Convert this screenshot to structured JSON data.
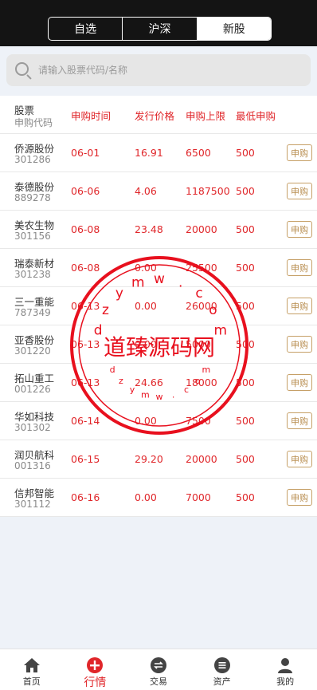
{
  "tabs": [
    {
      "label": "自选",
      "active": false
    },
    {
      "label": "沪深",
      "active": false
    },
    {
      "label": "新股",
      "active": true
    }
  ],
  "search": {
    "placeholder": "请输入股票代码/名称"
  },
  "table": {
    "headers": {
      "stock": "股票",
      "code": "申购代码",
      "date": "申购时间",
      "price": "发行价格",
      "limit": "申购上限",
      "min": "最低申购"
    },
    "apply_label": "申购",
    "rows": [
      {
        "name": "侨源股份",
        "code": "301286",
        "date": "06-01",
        "price": "16.91",
        "limit": "6500",
        "min": "500"
      },
      {
        "name": "泰德股份",
        "code": "889278",
        "date": "06-06",
        "price": "4.06",
        "limit": "1187500",
        "min": "500"
      },
      {
        "name": "美农生物",
        "code": "301156",
        "date": "06-08",
        "price": "23.48",
        "limit": "20000",
        "min": "500"
      },
      {
        "name": "瑞泰新材",
        "code": "301238",
        "date": "06-08",
        "price": "0.00",
        "limit": "25500",
        "min": "500"
      },
      {
        "name": "三一重能",
        "code": "787349",
        "date": "06-13",
        "price": "0.00",
        "limit": "26000",
        "min": "500"
      },
      {
        "name": "亚香股份",
        "code": "301220",
        "date": "06-13",
        "price": "0.00",
        "limit": "5000",
        "min": "500"
      },
      {
        "name": "拓山重工",
        "code": "001226",
        "date": "06-13",
        "price": "24.66",
        "limit": "18000",
        "min": "500"
      },
      {
        "name": "华如科技",
        "code": "301302",
        "date": "06-14",
        "price": "0.00",
        "limit": "7500",
        "min": "500"
      },
      {
        "name": "润贝航科",
        "code": "001316",
        "date": "06-15",
        "price": "29.20",
        "limit": "20000",
        "min": "500"
      },
      {
        "name": "信邦智能",
        "code": "301112",
        "date": "06-16",
        "price": "0.00",
        "limit": "7000",
        "min": "500"
      }
    ]
  },
  "watermark": {
    "text": "道臻源码网",
    "arc_text": "dzymw.com",
    "color": "#e8101e"
  },
  "bottom_nav": [
    {
      "label": "首页",
      "icon": "home-icon",
      "active": false
    },
    {
      "label": "行情",
      "icon": "plus-circle-icon",
      "active": true
    },
    {
      "label": "交易",
      "icon": "exchange-icon",
      "active": false
    },
    {
      "label": "资产",
      "icon": "wallet-icon",
      "active": false
    },
    {
      "label": "我的",
      "icon": "user-icon",
      "active": false
    }
  ],
  "colors": {
    "accent": "#e0262a",
    "apply_border": "#c6a067",
    "header_bg": "#141414"
  }
}
